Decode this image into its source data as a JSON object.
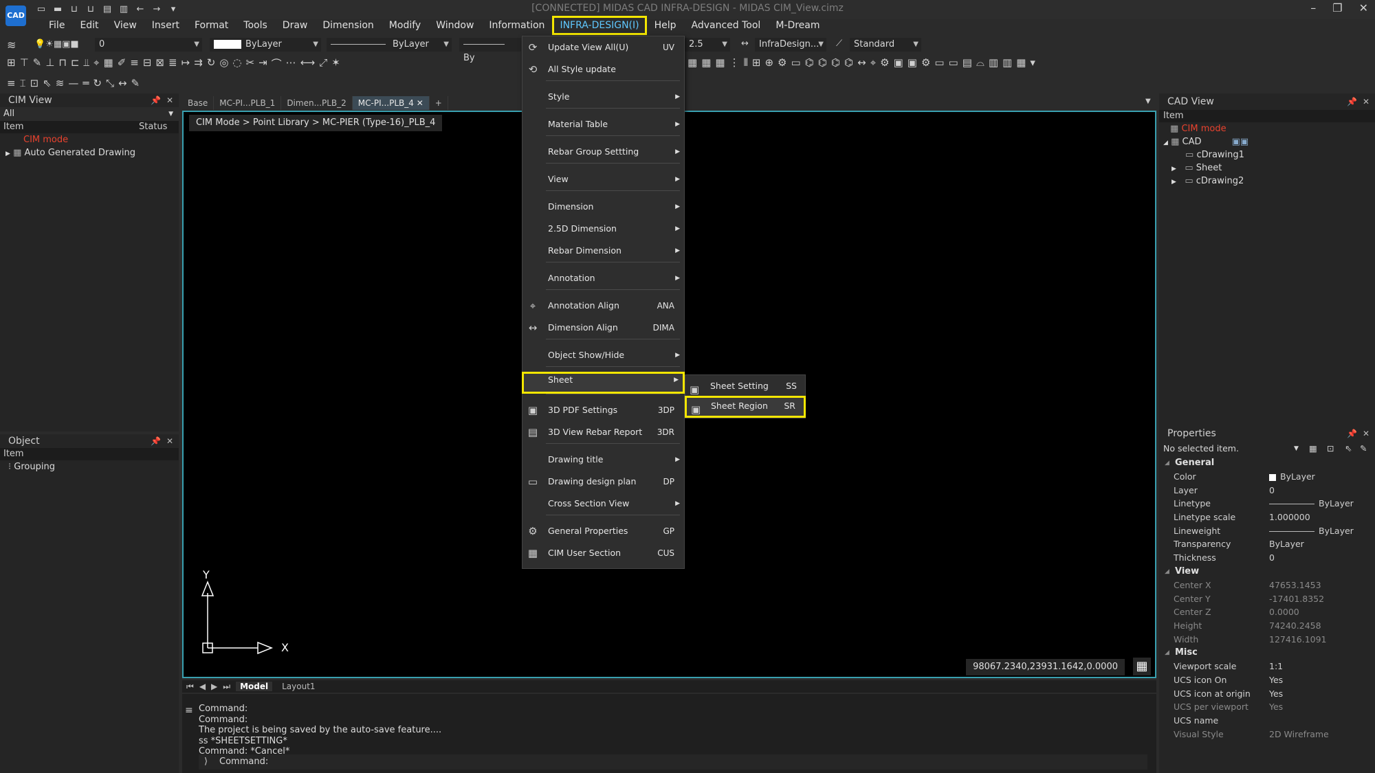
{
  "window": {
    "title": "[CONNECTED] MIDAS CAD INFRA-DESIGN - MIDAS CIM_View.cimz",
    "logo_text": "CAD",
    "controls": [
      "–",
      "❐",
      "✕"
    ]
  },
  "menubar": [
    {
      "label": "File",
      "active": false
    },
    {
      "label": "Edit",
      "active": false
    },
    {
      "label": "View",
      "active": false
    },
    {
      "label": "Insert",
      "active": false
    },
    {
      "label": "Format",
      "active": false
    },
    {
      "label": "Tools",
      "active": false
    },
    {
      "label": "Draw",
      "active": false
    },
    {
      "label": "Dimension",
      "active": false
    },
    {
      "label": "Modify",
      "active": false
    },
    {
      "label": "Window",
      "active": false
    },
    {
      "label": "Information",
      "active": false
    },
    {
      "label": "INFRA-DESIGN(I)",
      "active": true
    },
    {
      "label": "Help",
      "active": false
    },
    {
      "label": "Advanced Tool",
      "active": false
    },
    {
      "label": "M-Dream",
      "active": false
    }
  ],
  "toolbar": {
    "layer_value": "0",
    "color_value": "ByLayer",
    "linetype_value": "ByLayer",
    "lineweight_value": "By",
    "dimscale_value": "2.5",
    "dimstyle_value": "InfraDesign...",
    "textstyle_value": "Standard"
  },
  "cim_view": {
    "title": "CIM View",
    "filter": "All",
    "col_item": "Item",
    "col_status": "Status",
    "rows": [
      {
        "label": "CIM mode",
        "red": true
      },
      {
        "label": "Auto Generated Drawing",
        "red": false
      }
    ]
  },
  "object_panel": {
    "title": "Object",
    "col_item": "Item",
    "rows": [
      {
        "label": "Grouping"
      }
    ]
  },
  "doc_tabs": [
    {
      "label": "Base",
      "active": false
    },
    {
      "label": "MC-PI...PLB_1",
      "active": false
    },
    {
      "label": "Dimen...PLB_2",
      "active": false
    },
    {
      "label": "MC-PI...PLB_4",
      "active": true
    }
  ],
  "canvas": {
    "breadcrumb": "CIM Mode > Point Library > MC-PIER (Type-16)_PLB_4",
    "coords": "98067.2340,23931.1642,0.0000",
    "axis_y": "Y",
    "axis_x": "X"
  },
  "layout_tabs": [
    {
      "label": "Model",
      "active": true
    },
    {
      "label": "Layout1",
      "active": false
    }
  ],
  "command": {
    "history": [
      "Command:",
      "Command:",
      "The project is being saved by the auto-save feature....",
      "ss *SHEETSETTING*",
      "Command:  *Cancel*"
    ],
    "prompt": "Command:"
  },
  "dropdown": {
    "items": [
      {
        "label": "Update View All(U)",
        "shortcut": "UV",
        "submenu": false,
        "icon": "update-view-icon",
        "glyph": "⟳"
      },
      {
        "label": "All Style update",
        "shortcut": "",
        "submenu": false,
        "icon": "style-update-icon",
        "glyph": "⟲"
      },
      {
        "label": "Style",
        "shortcut": "",
        "submenu": true
      },
      {
        "label": "Material Table",
        "shortcut": "",
        "submenu": true
      },
      {
        "label": "Rebar Group Settting",
        "shortcut": "",
        "submenu": true
      },
      {
        "label": "View",
        "shortcut": "",
        "submenu": true
      },
      {
        "label": "Dimension",
        "shortcut": "",
        "submenu": true
      },
      {
        "label": "2.5D Dimension",
        "shortcut": "",
        "submenu": true
      },
      {
        "label": "Rebar Dimension",
        "shortcut": "",
        "submenu": true
      },
      {
        "label": "Annotation",
        "shortcut": "",
        "submenu": true
      },
      {
        "label": "Annotation Align",
        "shortcut": "ANA",
        "submenu": false,
        "icon": "annotation-align-icon",
        "glyph": "⌖"
      },
      {
        "label": "Dimension Align",
        "shortcut": "DIMA",
        "submenu": false,
        "icon": "dimension-align-icon",
        "glyph": "↔"
      },
      {
        "label": "Object Show/Hide",
        "shortcut": "",
        "submenu": true
      },
      {
        "label": "Sheet",
        "shortcut": "",
        "submenu": true,
        "highlight": true
      },
      {
        "label": "3D PDF Settings",
        "shortcut": "3DP",
        "submenu": false,
        "icon": "pdf-settings-icon",
        "glyph": "▣"
      },
      {
        "label": "3D View Rebar Report",
        "shortcut": "3DR",
        "submenu": false,
        "icon": "rebar-report-icon",
        "glyph": "▤"
      },
      {
        "label": "Drawing title",
        "shortcut": "",
        "submenu": true
      },
      {
        "label": "Drawing design plan",
        "shortcut": "DP",
        "submenu": false,
        "icon": "design-plan-icon",
        "glyph": "▭"
      },
      {
        "label": "Cross Section View",
        "shortcut": "",
        "submenu": true
      },
      {
        "label": "General Properties",
        "shortcut": "GP",
        "submenu": false,
        "icon": "gear-icon",
        "glyph": "⚙"
      },
      {
        "label": "CIM User Section",
        "shortcut": "CUS",
        "submenu": false,
        "icon": "user-section-icon",
        "glyph": "▦"
      }
    ]
  },
  "submenu": {
    "items": [
      {
        "label": "Sheet Setting",
        "shortcut": "SS",
        "highlight": false
      },
      {
        "label": "Sheet Region",
        "shortcut": "SR",
        "highlight": true
      }
    ]
  },
  "cad_view": {
    "title": "CAD View",
    "col_item": "Item",
    "rows": [
      {
        "label": "CIM mode",
        "red": true,
        "indent": 0
      },
      {
        "label": "CAD",
        "red": false,
        "indent": 1
      },
      {
        "label": "cDrawing1",
        "red": false,
        "indent": 2
      },
      {
        "label": "Sheet",
        "red": false,
        "indent": 2
      },
      {
        "label": "cDrawing2",
        "red": false,
        "indent": 2
      }
    ]
  },
  "properties": {
    "title": "Properties",
    "selection": "No selected item.",
    "sections": [
      {
        "name": "General",
        "rows": [
          {
            "k": "Color",
            "v": "ByLayer",
            "dim": false
          },
          {
            "k": "Layer",
            "v": "0",
            "dim": false
          },
          {
            "k": "Linetype",
            "v": "ByLayer",
            "dim": false
          },
          {
            "k": "Linetype scale",
            "v": "1.000000",
            "dim": false
          },
          {
            "k": "Lineweight",
            "v": "ByLayer",
            "dim": false
          },
          {
            "k": "Transparency",
            "v": "ByLayer",
            "dim": false
          },
          {
            "k": "Thickness",
            "v": "0",
            "dim": false
          }
        ]
      },
      {
        "name": "View",
        "rows": [
          {
            "k": "Center X",
            "v": "47653.1453",
            "dim": true
          },
          {
            "k": "Center Y",
            "v": "-17401.8352",
            "dim": true
          },
          {
            "k": "Center Z",
            "v": "0.0000",
            "dim": true
          },
          {
            "k": "Height",
            "v": "74240.2458",
            "dim": true
          },
          {
            "k": "Width",
            "v": "127416.1091",
            "dim": true
          }
        ]
      },
      {
        "name": "Misc",
        "rows": [
          {
            "k": "Viewport scale",
            "v": "1:1",
            "dim": false
          },
          {
            "k": "UCS icon On",
            "v": "Yes",
            "dim": false
          },
          {
            "k": "UCS icon at origin",
            "v": "Yes",
            "dim": false
          },
          {
            "k": "UCS per viewport",
            "v": "Yes",
            "dim": true
          },
          {
            "k": "UCS name",
            "v": "",
            "dim": false
          },
          {
            "k": "Visual Style",
            "v": "2D Wireframe",
            "dim": true
          }
        ]
      }
    ]
  },
  "colors": {
    "accent_highlight": "#f4e600",
    "active_menu_text": "#5fc8ff",
    "cim_mode_red": "#e8422e",
    "canvas_border": "#39a0b0"
  }
}
